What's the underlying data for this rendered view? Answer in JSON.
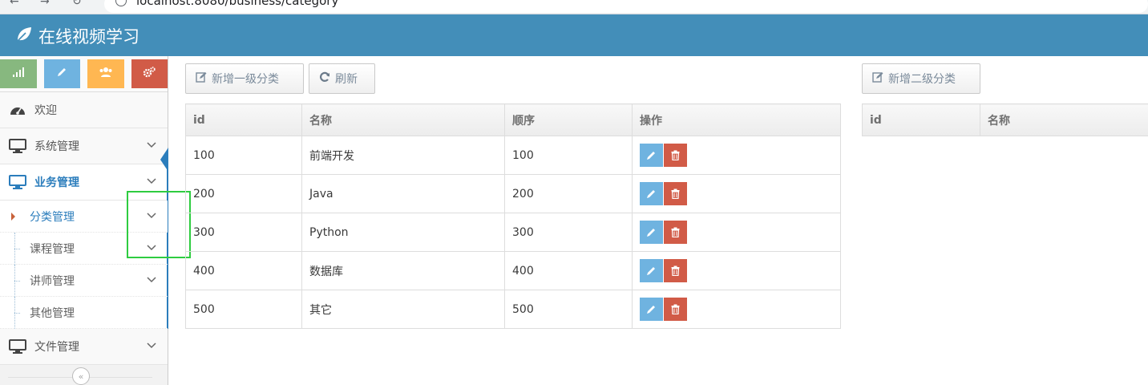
{
  "browser": {
    "url": "localhost:8080/business/category"
  },
  "app": {
    "title": "在线视频学习"
  },
  "shortcuts": [
    {
      "icon": "signal-icon",
      "color": "#87b87f"
    },
    {
      "icon": "pencil-icon",
      "color": "#6fb3e0"
    },
    {
      "icon": "users-icon",
      "color": "#ffb752"
    },
    {
      "icon": "cogs-icon",
      "color": "#d15b47"
    }
  ],
  "sidebar": {
    "welcome": "欢迎",
    "system": "系统管理",
    "business": "业务管理",
    "business_sub": [
      "分类管理",
      "课程管理",
      "讲师管理",
      "其他管理"
    ],
    "file": "文件管理"
  },
  "toolbar": {
    "add_level1": "新增一级分类",
    "refresh": "刷新",
    "add_level2": "新增二级分类"
  },
  "level1_table": {
    "headers": [
      "id",
      "名称",
      "顺序",
      "操作"
    ],
    "rows": [
      {
        "id": "100",
        "name": "前端开发",
        "sort": "100"
      },
      {
        "id": "200",
        "name": "Java",
        "sort": "200"
      },
      {
        "id": "300",
        "name": "Python",
        "sort": "300"
      },
      {
        "id": "400",
        "name": "数据库",
        "sort": "400"
      },
      {
        "id": "500",
        "name": "其它",
        "sort": "500"
      }
    ]
  },
  "level2_table": {
    "headers": [
      "id",
      "名称"
    ]
  },
  "colors": {
    "navbar": "#438eb9",
    "accent": "#2b7dbc",
    "edit": "#6fb3e0",
    "delete": "#d15b47"
  }
}
